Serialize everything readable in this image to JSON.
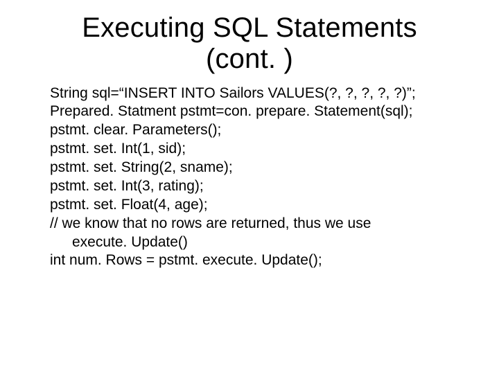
{
  "title_line1": "Executing SQL Statements",
  "title_line2": "(cont. )",
  "code": {
    "l1": "String sql=“INSERT INTO Sailors VALUES(?, ?, ?, ?, ?)”;",
    "l2": "Prepared. Statment pstmt=con. prepare. Statement(sql);",
    "l3": "pstmt. clear. Parameters();",
    "l4": "pstmt. set. Int(1, sid);",
    "l5": "pstmt. set. String(2, sname);",
    "l6": "pstmt. set. Int(3, rating);",
    "l7": "pstmt. set. Float(4, age);",
    "l8": "// we know that no rows are returned, thus we use",
    "l8b": "execute. Update()",
    "l9": "int num. Rows = pstmt. execute. Update();"
  }
}
